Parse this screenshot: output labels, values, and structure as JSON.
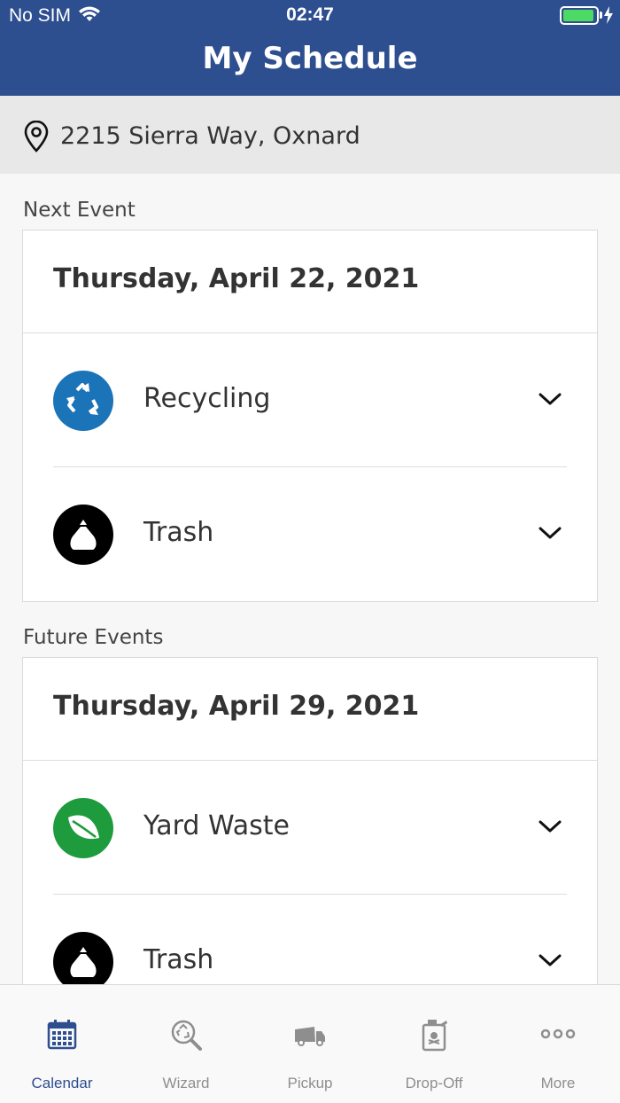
{
  "status_bar": {
    "carrier": "No SIM",
    "time": "02:47"
  },
  "header": {
    "title": "My Schedule"
  },
  "address": {
    "text": "2215 Sierra Way, Oxnard"
  },
  "next_event": {
    "section_label": "Next Event",
    "date": "Thursday, April 22, 2021",
    "events": [
      {
        "label": "Recycling",
        "icon": "recycling-icon",
        "color": "#1b73b8"
      },
      {
        "label": "Trash",
        "icon": "trash-bag-icon",
        "color": "#000000"
      }
    ]
  },
  "future_events": {
    "section_label": "Future Events",
    "date": "Thursday, April 29, 2021",
    "events": [
      {
        "label": "Yard Waste",
        "icon": "leaf-icon",
        "color": "#1e9b3c"
      },
      {
        "label": "Trash",
        "icon": "trash-bag-icon",
        "color": "#000000"
      }
    ]
  },
  "tabs": [
    {
      "label": "Calendar",
      "icon": "calendar-icon",
      "active": true
    },
    {
      "label": "Wizard",
      "icon": "wizard-search-icon",
      "active": false
    },
    {
      "label": "Pickup",
      "icon": "truck-icon",
      "active": false
    },
    {
      "label": "Drop-Off",
      "icon": "hazard-container-icon",
      "active": false
    },
    {
      "label": "More",
      "icon": "more-dots-icon",
      "active": false
    }
  ],
  "colors": {
    "brand": "#2d4e8f",
    "battery": "#4cd964",
    "inactive_tab": "#8e8e8e"
  }
}
